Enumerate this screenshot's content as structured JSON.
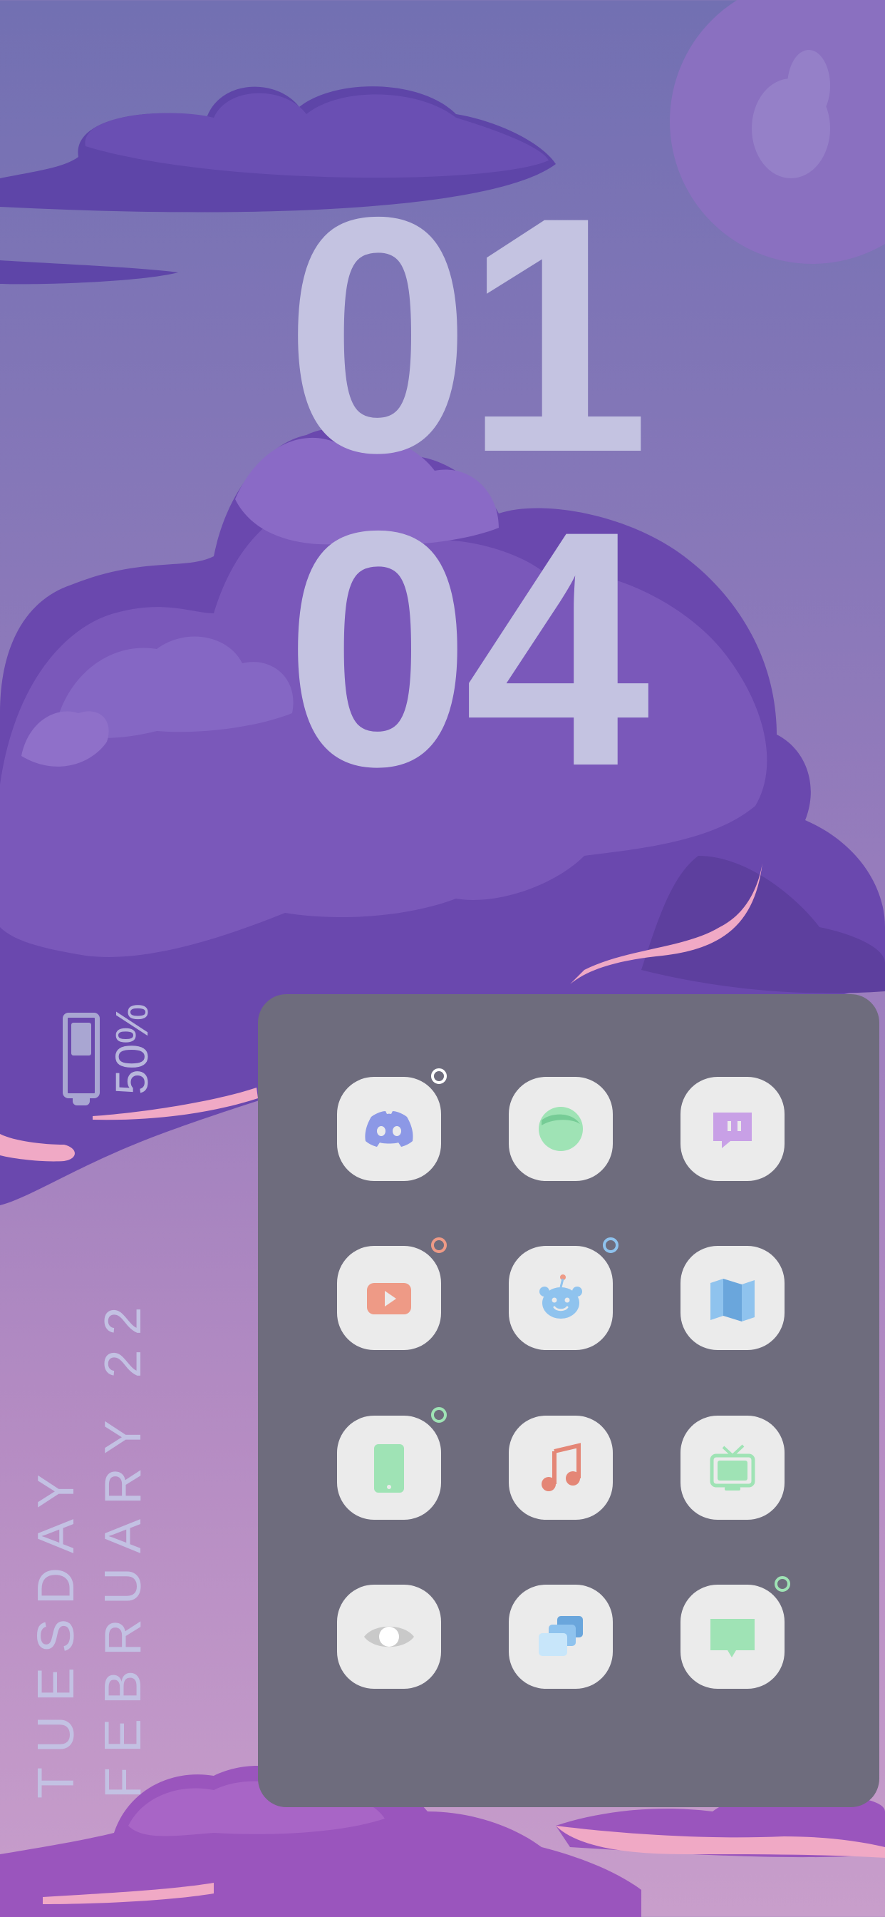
{
  "clock": {
    "hour": "01",
    "minute": "04"
  },
  "battery": {
    "level": 0.5,
    "label": "50%"
  },
  "date": {
    "weekday": "TUESDAY",
    "date": "FEBRUARY 22"
  },
  "apps": [
    {
      "name": "discord-icon",
      "badge_color": "#ffffff"
    },
    {
      "name": "green-ball-icon",
      "badge_color": null
    },
    {
      "name": "twitch-icon",
      "badge_color": null
    },
    {
      "name": "youtube-icon",
      "badge_color": "#ee9a86"
    },
    {
      "name": "reddit-icon",
      "badge_color": "#8fc3ee"
    },
    {
      "name": "maps-icon",
      "badge_color": null
    },
    {
      "name": "phone-icon",
      "badge_color": "#9fe3b5"
    },
    {
      "name": "music-icon",
      "badge_color": null
    },
    {
      "name": "tv-icon",
      "badge_color": null
    },
    {
      "name": "eye-icon",
      "badge_color": null
    },
    {
      "name": "stacked-cards-icon",
      "badge_color": null
    },
    {
      "name": "message-icon",
      "badge_color": "#9fe3b5"
    }
  ]
}
